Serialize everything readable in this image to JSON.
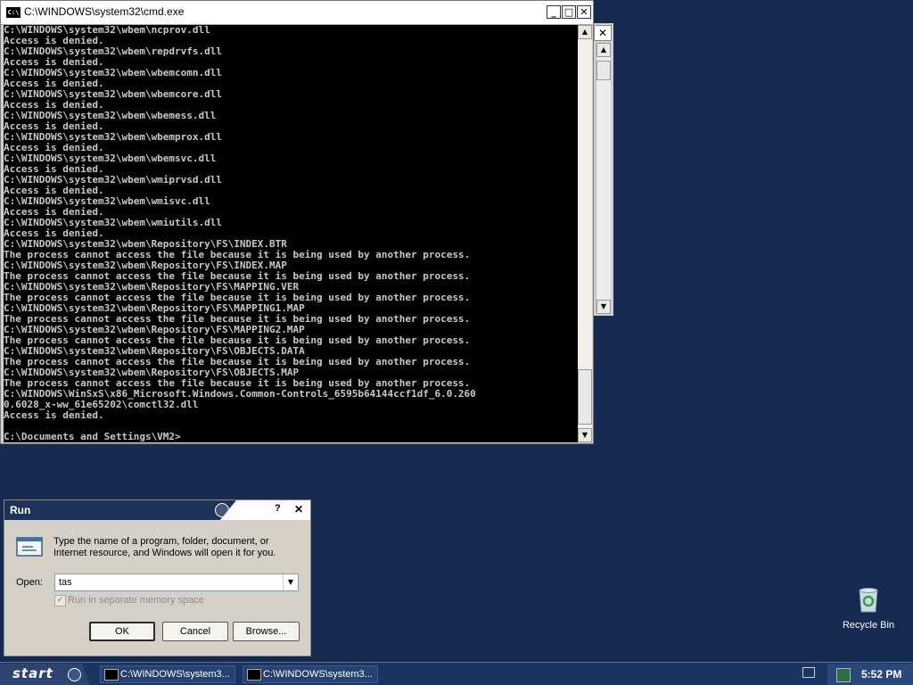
{
  "desktop": {
    "background_color": "#142a4f",
    "recycle_bin_label": "Recycle Bin"
  },
  "cmd_window": {
    "title": "C:\\WINDOWS\\system32\\cmd.exe",
    "minimize_label": "_",
    "maximize_label": "□",
    "close_label": "✕",
    "lines": [
      "C:\\WINDOWS\\system32\\wbem\\ncprov.dll",
      "Access is denied.",
      "C:\\WINDOWS\\system32\\wbem\\repdrvfs.dll",
      "Access is denied.",
      "C:\\WINDOWS\\system32\\wbem\\wbemcomn.dll",
      "Access is denied.",
      "C:\\WINDOWS\\system32\\wbem\\wbemcore.dll",
      "Access is denied.",
      "C:\\WINDOWS\\system32\\wbem\\wbemess.dll",
      "Access is denied.",
      "C:\\WINDOWS\\system32\\wbem\\wbemprox.dll",
      "Access is denied.",
      "C:\\WINDOWS\\system32\\wbem\\wbemsvc.dll",
      "Access is denied.",
      "C:\\WINDOWS\\system32\\wbem\\wmiprvsd.dll",
      "Access is denied.",
      "C:\\WINDOWS\\system32\\wbem\\wmisvc.dll",
      "Access is denied.",
      "C:\\WINDOWS\\system32\\wbem\\wmiutils.dll",
      "Access is denied.",
      "C:\\WINDOWS\\system32\\wbem\\Repository\\FS\\INDEX.BTR",
      "The process cannot access the file because it is being used by another process.",
      "C:\\WINDOWS\\system32\\wbem\\Repository\\FS\\INDEX.MAP",
      "The process cannot access the file because it is being used by another process.",
      "C:\\WINDOWS\\system32\\wbem\\Repository\\FS\\MAPPING.VER",
      "The process cannot access the file because it is being used by another process.",
      "C:\\WINDOWS\\system32\\wbem\\Repository\\FS\\MAPPING1.MAP",
      "The process cannot access the file because it is being used by another process.",
      "C:\\WINDOWS\\system32\\wbem\\Repository\\FS\\MAPPING2.MAP",
      "The process cannot access the file because it is being used by another process.",
      "C:\\WINDOWS\\system32\\wbem\\Repository\\FS\\OBJECTS.DATA",
      "The process cannot access the file because it is being used by another process.",
      "C:\\WINDOWS\\system32\\wbem\\Repository\\FS\\OBJECTS.MAP",
      "The process cannot access the file because it is being used by another process.",
      "C:\\WINDOWS\\WinSxS\\x86_Microsoft.Windows.Common-Controls_6595b64144ccf1df_6.0.260",
      "0.6028_x-ww_61e65202\\comctl32.dll",
      "Access is denied.",
      "",
      "C:\\Documents and Settings\\VM2>"
    ]
  },
  "background_window": {
    "close_label": "✕"
  },
  "run_dialog": {
    "title": "Run",
    "help_label": "?",
    "close_label": "✕",
    "description_line1": "Type the name of a program, folder, document, or",
    "description_line2": "Internet resource, and Windows will open it for you.",
    "open_label": "Open:",
    "open_value": "tas",
    "checkbox_label": "Run in separate memory space",
    "checkbox_checked": true,
    "ok_label": "OK",
    "cancel_label": "Cancel",
    "browse_label": "Browse..."
  },
  "taskbar": {
    "start_label": "start",
    "tasks": [
      {
        "label": "C:\\WINDOWS\\system3..."
      },
      {
        "label": "C:\\WINDOWS\\system3..."
      }
    ],
    "clock": "5:52 PM"
  }
}
